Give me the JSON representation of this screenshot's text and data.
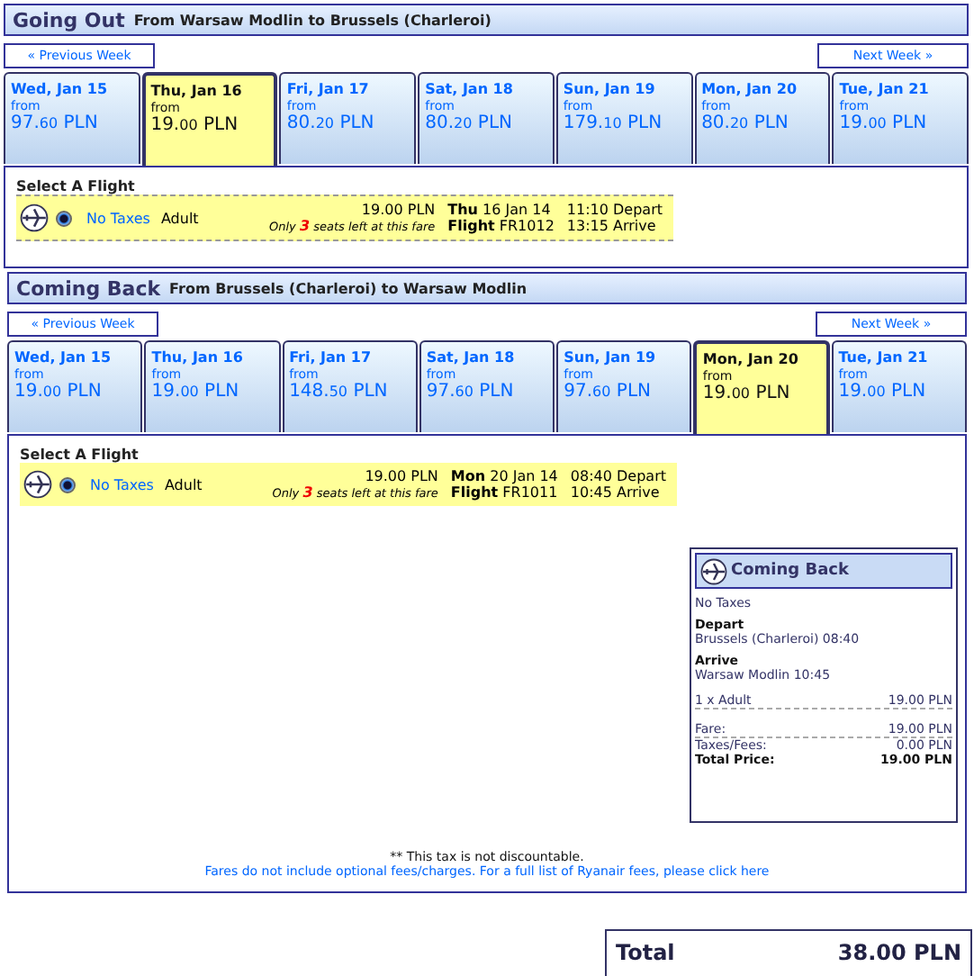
{
  "sections": [
    {
      "title": "Going Out",
      "route": "From Warsaw Modlin to Brussels (Charleroi)",
      "prev_week": "« Previous Week",
      "next_week": "Next Week »",
      "days": [
        {
          "label": "Wed, Jan 15",
          "from": "from",
          "whole": "97.",
          "cents": "60",
          "currency": "PLN",
          "selected": false
        },
        {
          "label": "Thu, Jan 16",
          "from": "from",
          "whole": "19.",
          "cents": "00",
          "currency": "PLN",
          "selected": true
        },
        {
          "label": "Fri, Jan 17",
          "from": "from",
          "whole": "80.",
          "cents": "20",
          "currency": "PLN",
          "selected": false
        },
        {
          "label": "Sat, Jan 18",
          "from": "from",
          "whole": "80.",
          "cents": "20",
          "currency": "PLN",
          "selected": false
        },
        {
          "label": "Sun, Jan 19",
          "from": "from",
          "whole": "179.",
          "cents": "10",
          "currency": "PLN",
          "selected": false
        },
        {
          "label": "Mon, Jan 20",
          "from": "from",
          "whole": "80.",
          "cents": "20",
          "currency": "PLN",
          "selected": false
        },
        {
          "label": "Tue, Jan 21",
          "from": "from",
          "whole": "19.",
          "cents": "00",
          "currency": "PLN",
          "selected": false
        }
      ],
      "select_heading": "Select A Flight",
      "flights": [
        {
          "fare": "No Taxes",
          "passenger": "Adult",
          "price": "19.00 PLN",
          "note": "Only **3** seats left at this fare",
          "date": "**Thu** 16 Jan 14",
          "flight": "**Flight** FR1012",
          "depart": "11:10 Depart",
          "arrive": "13:15 Arrive",
          "selected": true
        }
      ]
    },
    {
      "title": "Coming Back",
      "route": "From Brussels (Charleroi) to Warsaw Modlin",
      "prev_week": "« Previous Week",
      "next_week": "Next Week »",
      "days": [
        {
          "label": "Wed, Jan 15",
          "from": "from",
          "whole": "19.",
          "cents": "00",
          "currency": "PLN",
          "selected": false
        },
        {
          "label": "Thu, Jan 16",
          "from": "from",
          "whole": "19.",
          "cents": "00",
          "currency": "PLN",
          "selected": false
        },
        {
          "label": "Fri, Jan 17",
          "from": "from",
          "whole": "148.",
          "cents": "50",
          "currency": "PLN",
          "selected": false
        },
        {
          "label": "Sat, Jan 18",
          "from": "from",
          "whole": "97.",
          "cents": "60",
          "currency": "PLN",
          "selected": false
        },
        {
          "label": "Sun, Jan 19",
          "from": "from",
          "whole": "97.",
          "cents": "60",
          "currency": "PLN",
          "selected": false
        },
        {
          "label": "Mon, Jan 20",
          "from": "from",
          "whole": "19.",
          "cents": "00",
          "currency": "PLN",
          "selected": true
        },
        {
          "label": "Tue, Jan 21",
          "from": "from",
          "whole": "19.",
          "cents": "00",
          "currency": "PLN",
          "selected": false
        }
      ],
      "select_heading": "Select A Flight",
      "flights": [
        {
          "fare": "No Taxes",
          "passenger": "Adult",
          "price": "19.00 PLN",
          "note": "Only **3** seats left at this fare",
          "date": "**Mon** 20 Jan 14",
          "flight": "**Flight** FR1011",
          "depart": "08:40 Depart",
          "arrive": "10:45 Arrive",
          "selected": true
        }
      ],
      "summary": {
        "title": "Coming Back",
        "fare": "No Taxes",
        "depart_label": "Depart",
        "depart": "Brussels (Charleroi) 08:40",
        "arrive_label": "Arrive",
        "arrive": "Warsaw Modlin 10:45",
        "lines": [
          {
            "label": "1 x Adult",
            "amount": "19.00 PLN",
            "kind": "item"
          },
          {
            "label": "Fare:",
            "amount": "19.00 PLN",
            "kind": "fare"
          },
          {
            "label": "Taxes/Fees:",
            "amount": "0.00 PLN",
            "kind": "plain"
          },
          {
            "label": "Total Price:",
            "amount": "19.00 PLN",
            "kind": "total"
          }
        ]
      },
      "footnote": "** This tax is not discountable.",
      "fees_link": "Fares do not include optional fees/charges. For a full list of Ryanair fees, please click here"
    }
  ],
  "total": {
    "label": "Total",
    "amount": "38.00 PLN"
  }
}
